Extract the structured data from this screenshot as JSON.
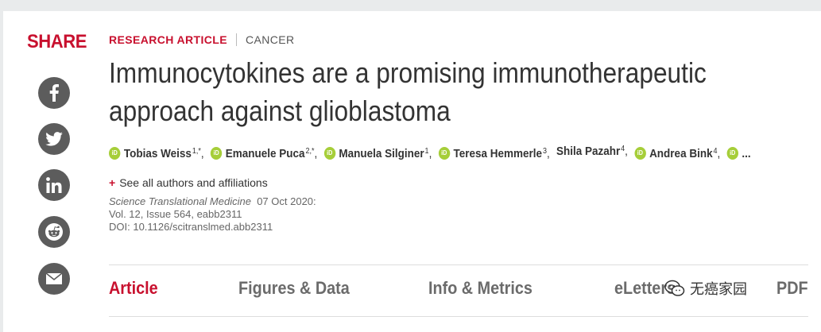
{
  "share": {
    "title": "SHARE",
    "buttons": [
      {
        "name": "facebook-share-button",
        "icon": "facebook-icon"
      },
      {
        "name": "twitter-share-button",
        "icon": "twitter-icon"
      },
      {
        "name": "linkedin-share-button",
        "icon": "linkedin-icon"
      },
      {
        "name": "reddit-share-button",
        "icon": "reddit-icon"
      },
      {
        "name": "email-share-button",
        "icon": "mail-icon"
      }
    ]
  },
  "article": {
    "type": "RESEARCH ARTICLE",
    "section": "CANCER",
    "title_line1": "Immunocytokines are a promising immunotherapeutic",
    "title_line2": "approach against glioblastoma",
    "authors": [
      {
        "name": "Tobias Weiss",
        "sup": "1,*",
        "orcid": true
      },
      {
        "name": "Emanuele Puca",
        "sup": "2,*",
        "orcid": true
      },
      {
        "name": "Manuela Silginer",
        "sup": "1",
        "orcid": true
      },
      {
        "name": "Teresa Hemmerle",
        "sup": "3",
        "orcid": true
      },
      {
        "name": "Shila Pazahr",
        "sup": "4",
        "orcid": false
      },
      {
        "name": "Andrea Bink",
        "sup": "4",
        "orcid": true
      }
    ],
    "authors_more": "...",
    "orcid_label": "iD",
    "see_all_plus": "+",
    "see_all": "See all authors and affiliations",
    "journal": "Science Translational Medicine",
    "date": "07 Oct 2020:",
    "volume": "Vol. 12, Issue 564, eabb2311",
    "doi": "DOI: 10.1126/scitranslmed.abb2311"
  },
  "tabs": [
    {
      "label": "Article",
      "active": true
    },
    {
      "label": "Figures & Data",
      "active": false
    },
    {
      "label": "Info & Metrics",
      "active": false
    },
    {
      "label": "eLetters",
      "active": false
    },
    {
      "label": "PDF",
      "active": false
    }
  ],
  "watermark": {
    "text": "无癌家园",
    "icon": "wechat-icon"
  },
  "colors": {
    "accent": "#c8102e",
    "orcid": "#a6ce39",
    "share_bg": "#5c5c5c"
  }
}
